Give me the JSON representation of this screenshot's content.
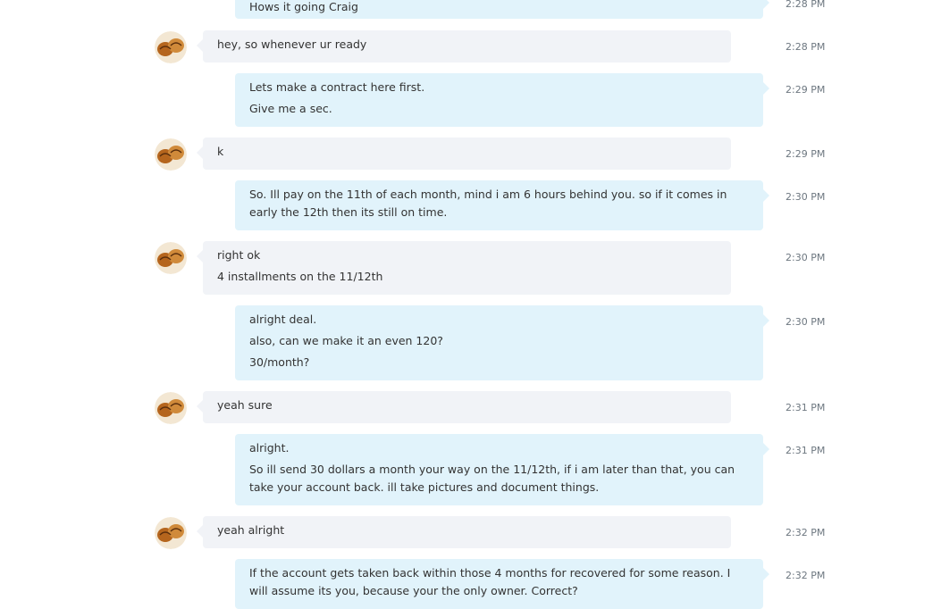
{
  "messages": [
    {
      "dir": "out",
      "time": "2:28 PM",
      "lines": [
        "Hows it going Craig"
      ]
    },
    {
      "dir": "in",
      "time": "2:28 PM",
      "lines": [
        "hey, so whenever ur ready"
      ]
    },
    {
      "dir": "out",
      "time": "2:29 PM",
      "lines": [
        "Lets make a contract here first.",
        "Give me a sec."
      ]
    },
    {
      "dir": "in",
      "time": "2:29 PM",
      "lines": [
        "k"
      ]
    },
    {
      "dir": "out",
      "time": "2:30 PM",
      "lines": [
        "So. Ill pay on the 11th of each month, mind i am 6 hours behind you. so if it comes in early the 12th then its still on time."
      ]
    },
    {
      "dir": "in",
      "time": "2:30 PM",
      "lines": [
        "right ok",
        "4 installments on the 11/12th"
      ]
    },
    {
      "dir": "out",
      "time": "2:30 PM",
      "lines": [
        "alright deal.",
        "also, can we make it an even 120?",
        "30/month?"
      ]
    },
    {
      "dir": "in",
      "time": "2:31 PM",
      "lines": [
        "yeah sure"
      ]
    },
    {
      "dir": "out",
      "time": "2:31 PM",
      "lines": [
        "alright.",
        "So ill send 30 dollars a month your way on the 11/12th, if i am later than that, you can take your account back. ill take pictures and document things."
      ]
    },
    {
      "dir": "in",
      "time": "2:32 PM",
      "lines": [
        "yeah alright"
      ]
    },
    {
      "dir": "out",
      "time": "2:32 PM",
      "lines": [
        "If the account gets taken back within those 4 months for recovered for some reason. I will assume its you, because your the only owner. Correct?"
      ]
    }
  ],
  "avatar_icon": "contact-avatar-icon",
  "colors": {
    "incoming_bubble": "#f1f3f7",
    "outgoing_bubble": "#e1f3fb",
    "timestamp": "#6d7780"
  }
}
